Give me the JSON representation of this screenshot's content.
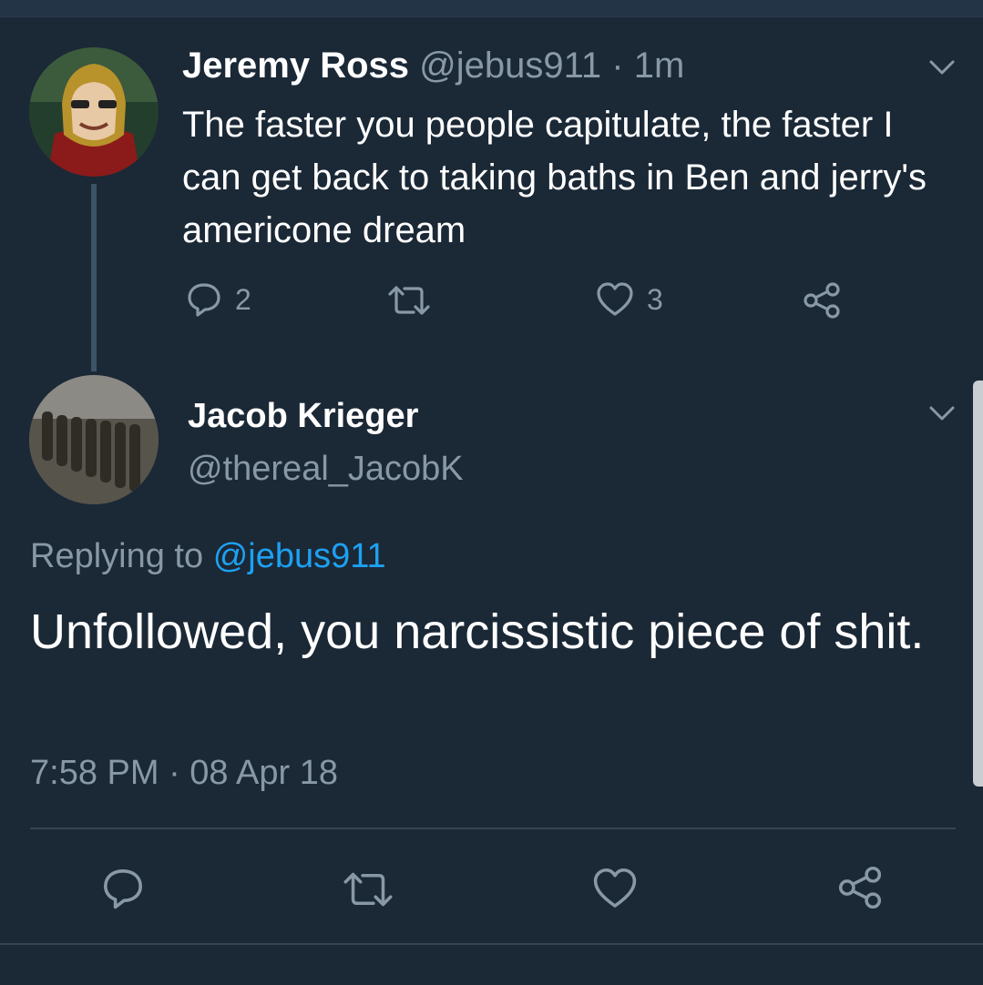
{
  "tweet1": {
    "name": "Jeremy Ross",
    "handle": "@jebus911",
    "separator": " · ",
    "time": "1m",
    "text": "The faster you people capitulate, the faster I can get back to taking baths in Ben and jerry's americone dream",
    "reply_count": "2",
    "like_count": "3",
    "avatar": "iron-man-helmet-avatar"
  },
  "tweet2": {
    "name": "Jacob Krieger",
    "handle": "@thereal_JacobK",
    "replying_prefix": "Replying to",
    "replying_to": "@jebus911",
    "text": "Unfollowed, you narcissistic piece of shit.",
    "timestamp": "7:58 PM · 08 Apr 18",
    "avatar": "marching-soldiers-avatar"
  },
  "icons": [
    "reply-icon",
    "retweet-icon",
    "like-icon",
    "share-icon",
    "chevron-down-icon"
  ],
  "colors": {
    "background": "#1b2836",
    "secondary_text": "#8899a6",
    "link": "#1da1f2",
    "thread_line": "#3d5466"
  }
}
